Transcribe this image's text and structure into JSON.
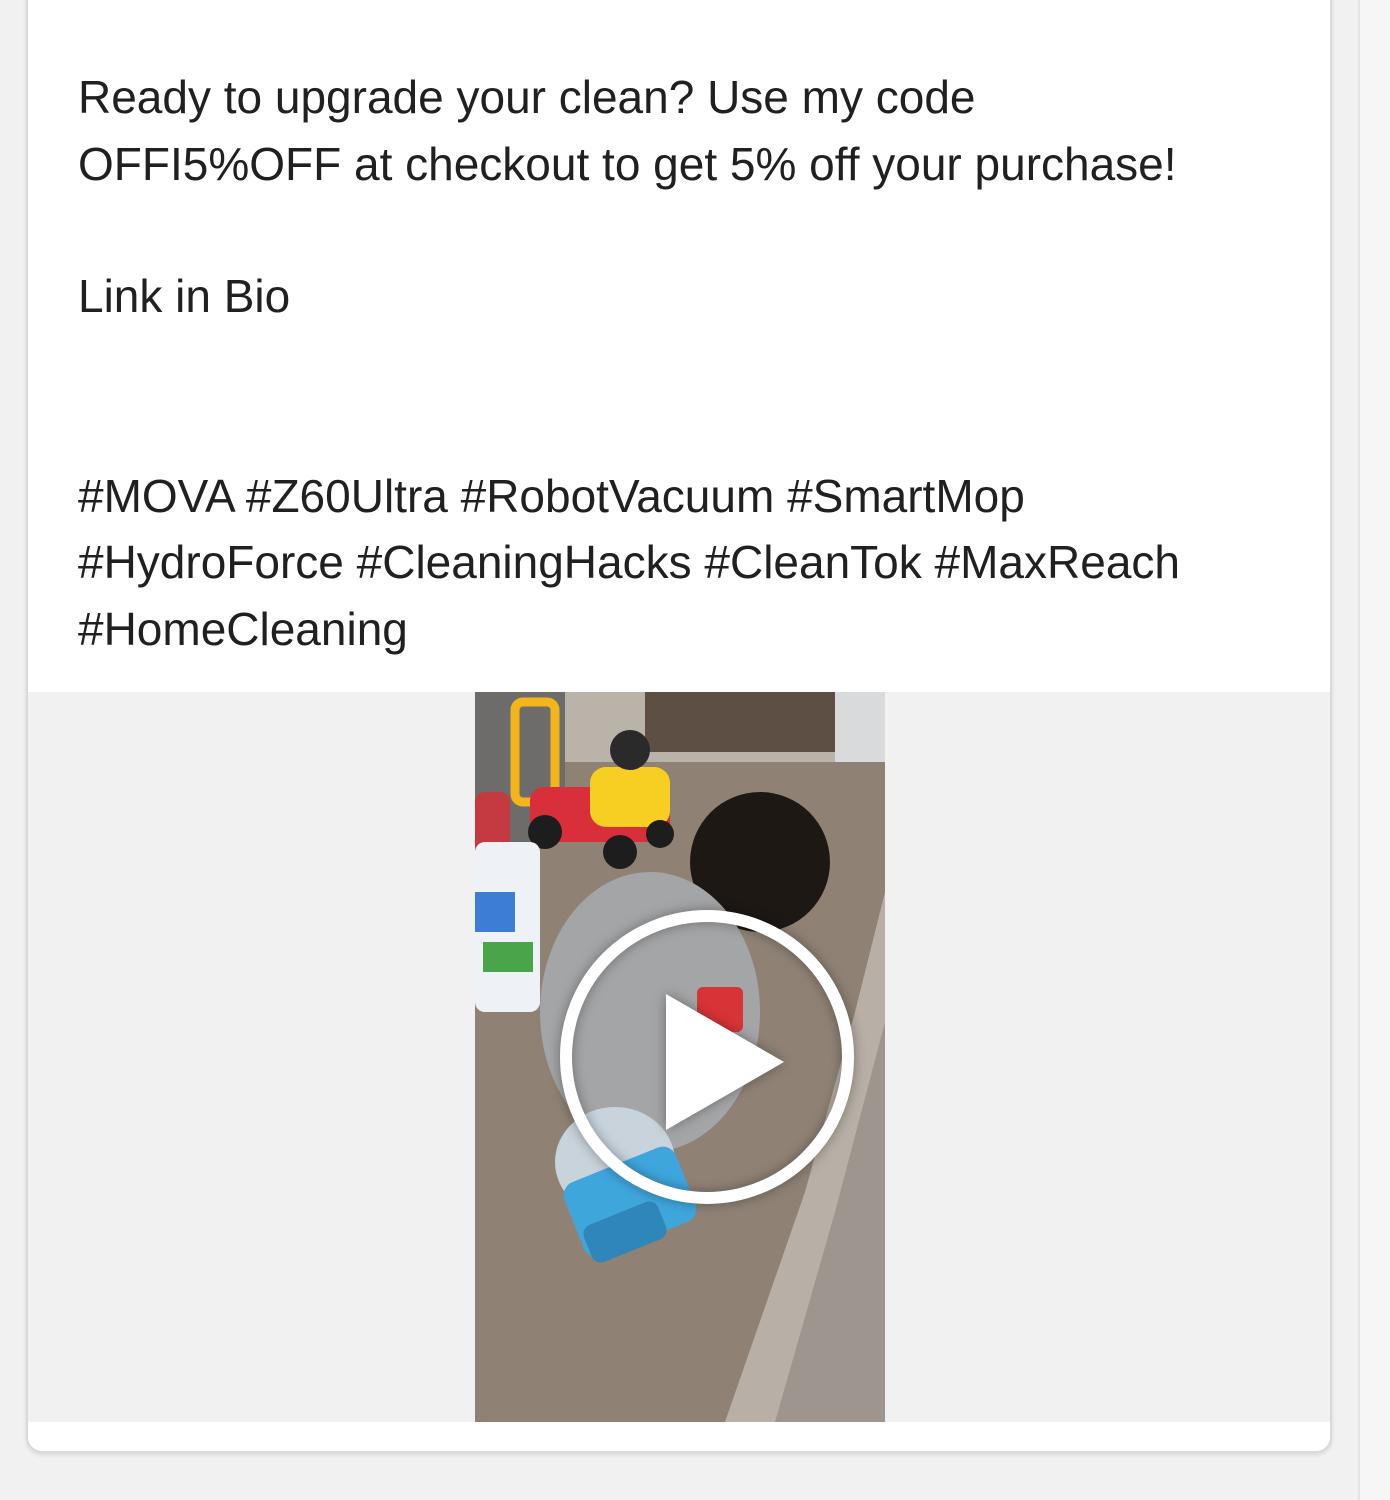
{
  "post": {
    "caption": {
      "promo": "Ready to upgrade your clean? Use my code\nOFFI5%OFF at checkout to get 5% off your purchase!",
      "link": "Link in Bio",
      "hashtags": "#MOVA #Z60Ultra #RobotVacuum #SmartMop\n#HydroForce #CleaningHacks #CleanTok #MaxReach\n#HomeCleaning"
    },
    "video": {
      "play_icon": "play-icon"
    }
  }
}
